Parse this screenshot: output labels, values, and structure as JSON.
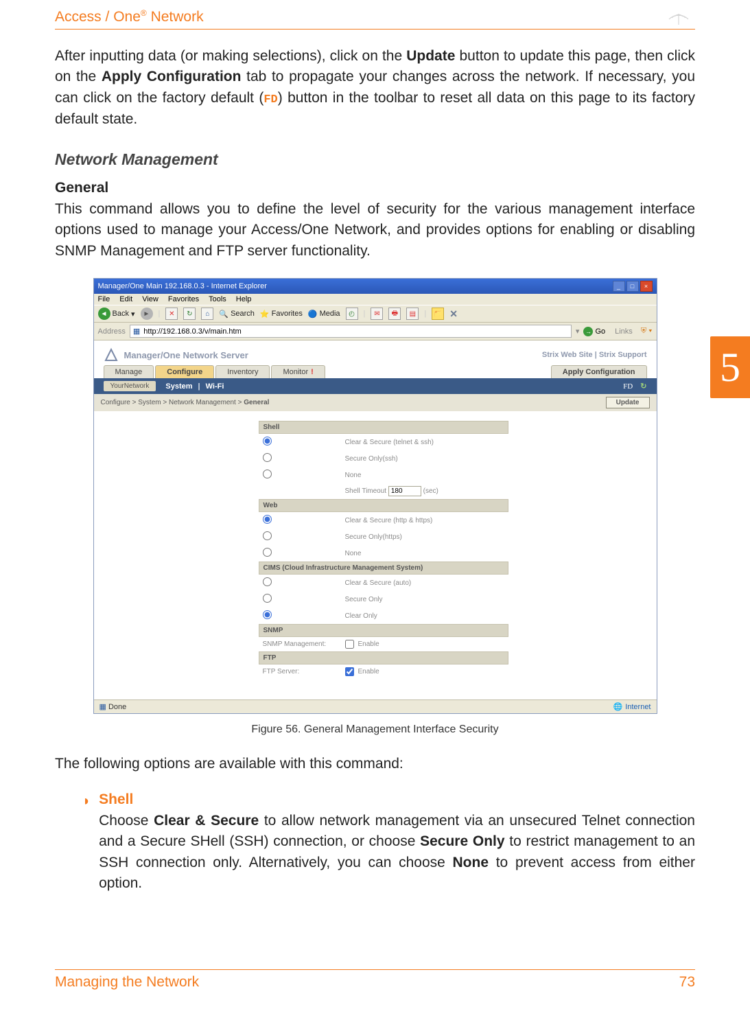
{
  "header": {
    "title_prefix": "Access / One",
    "title_reg": "®",
    "title_suffix": " Network"
  },
  "chapter_tab": "5",
  "para1_a": "After inputting data (or making selections), click on the ",
  "para1_update": "Update",
  "para1_b": " button to update this page, then click on the ",
  "para1_apply": "Apply Configuration",
  "para1_c": " tab to propagate your changes across the network. If necessary, you can click on the factory default (",
  "para1_fd": "FD",
  "para1_d": ") button in the toolbar to reset all data on this page to its factory default state.",
  "section_title": "Network Management",
  "sub_title": "General",
  "para2": "This command allows you to define the level of security for the various management interface options used to manage your Access/One Network, and provides options for enabling or disabling SNMP Management and FTP server functionality.",
  "figure_caption": "Figure 56. General Management Interface Security",
  "para3": "The following options are available with this command:",
  "bullet": {
    "title": "Shell",
    "text_a": "Choose ",
    "text_clear": "Clear & Secure",
    "text_b": " to allow network management via an unsecured Telnet connection and a Secure SHell (SSH) connection, or choose ",
    "text_secure": "Secure Only",
    "text_c": " to restrict management to an SSH connection only. Alternatively, you can choose ",
    "text_none": "None",
    "text_d": " to prevent access from either option."
  },
  "footer": {
    "left": "Managing the Network",
    "right": "73"
  },
  "screenshot": {
    "titlebar": "Manager/One Main 192.168.0.3 - Internet Explorer",
    "menus": [
      "File",
      "Edit",
      "View",
      "Favorites",
      "Tools",
      "Help"
    ],
    "toolbar": {
      "back": "Back",
      "search": "Search",
      "favorites": "Favorites",
      "media": "Media"
    },
    "address_label": "Address",
    "url": "http://192.168.0.3/v/main.htm",
    "go": "Go",
    "links": "Links",
    "brand": "Manager/One Network Server",
    "site_links": "Strix Web Site   |   Strix Support",
    "tabs": {
      "manage": "Manage",
      "configure": "Configure",
      "inventory": "Inventory",
      "monitor": "Monitor",
      "apply": "Apply Configuration"
    },
    "subtabs": {
      "yournetwork": "YourNetwork",
      "system": "System",
      "wifi": "Wi-Fi",
      "fd": "FD"
    },
    "crumb": "Configure > System > Network Management > General",
    "update_btn": "Update",
    "sections": {
      "shell": {
        "title": "Shell",
        "opt1": "Clear & Secure (telnet & ssh)",
        "opt2": "Secure Only(ssh)",
        "opt3": "None",
        "timeout_label": "Shell Timeout",
        "timeout_value": "180",
        "timeout_unit": "(sec)"
      },
      "web": {
        "title": "Web",
        "opt1": "Clear & Secure (http & https)",
        "opt2": "Secure Only(https)",
        "opt3": "None"
      },
      "cims": {
        "title": "CIMS (Cloud Infrastructure Management System)",
        "opt1": "Clear & Secure (auto)",
        "opt2": "Secure Only",
        "opt3": "Clear Only"
      },
      "snmp": {
        "title": "SNMP",
        "label": "SNMP Management:",
        "opt": "Enable"
      },
      "ftp": {
        "title": "FTP",
        "label": "FTP Server:",
        "opt": "Enable"
      }
    },
    "status_left": "Done",
    "status_right": "Internet"
  }
}
